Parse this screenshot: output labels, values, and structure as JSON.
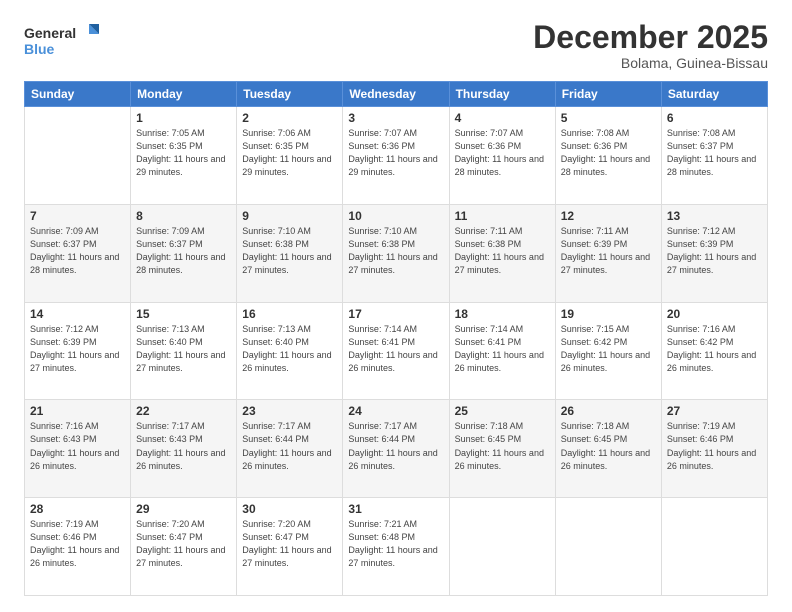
{
  "logo": {
    "line1": "General",
    "line2": "Blue"
  },
  "title": "December 2025",
  "location": "Bolama, Guinea-Bissau",
  "weekdays": [
    "Sunday",
    "Monday",
    "Tuesday",
    "Wednesday",
    "Thursday",
    "Friday",
    "Saturday"
  ],
  "weeks": [
    [
      {
        "day": "",
        "sunrise": "",
        "sunset": "",
        "daylight": ""
      },
      {
        "day": "1",
        "sunrise": "7:05 AM",
        "sunset": "6:35 PM",
        "daylight": "11 hours and 29 minutes."
      },
      {
        "day": "2",
        "sunrise": "7:06 AM",
        "sunset": "6:35 PM",
        "daylight": "11 hours and 29 minutes."
      },
      {
        "day": "3",
        "sunrise": "7:07 AM",
        "sunset": "6:36 PM",
        "daylight": "11 hours and 29 minutes."
      },
      {
        "day": "4",
        "sunrise": "7:07 AM",
        "sunset": "6:36 PM",
        "daylight": "11 hours and 28 minutes."
      },
      {
        "day": "5",
        "sunrise": "7:08 AM",
        "sunset": "6:36 PM",
        "daylight": "11 hours and 28 minutes."
      },
      {
        "day": "6",
        "sunrise": "7:08 AM",
        "sunset": "6:37 PM",
        "daylight": "11 hours and 28 minutes."
      }
    ],
    [
      {
        "day": "7",
        "sunrise": "7:09 AM",
        "sunset": "6:37 PM",
        "daylight": "11 hours and 28 minutes."
      },
      {
        "day": "8",
        "sunrise": "7:09 AM",
        "sunset": "6:37 PM",
        "daylight": "11 hours and 28 minutes."
      },
      {
        "day": "9",
        "sunrise": "7:10 AM",
        "sunset": "6:38 PM",
        "daylight": "11 hours and 27 minutes."
      },
      {
        "day": "10",
        "sunrise": "7:10 AM",
        "sunset": "6:38 PM",
        "daylight": "11 hours and 27 minutes."
      },
      {
        "day": "11",
        "sunrise": "7:11 AM",
        "sunset": "6:38 PM",
        "daylight": "11 hours and 27 minutes."
      },
      {
        "day": "12",
        "sunrise": "7:11 AM",
        "sunset": "6:39 PM",
        "daylight": "11 hours and 27 minutes."
      },
      {
        "day": "13",
        "sunrise": "7:12 AM",
        "sunset": "6:39 PM",
        "daylight": "11 hours and 27 minutes."
      }
    ],
    [
      {
        "day": "14",
        "sunrise": "7:12 AM",
        "sunset": "6:39 PM",
        "daylight": "11 hours and 27 minutes."
      },
      {
        "day": "15",
        "sunrise": "7:13 AM",
        "sunset": "6:40 PM",
        "daylight": "11 hours and 27 minutes."
      },
      {
        "day": "16",
        "sunrise": "7:13 AM",
        "sunset": "6:40 PM",
        "daylight": "11 hours and 26 minutes."
      },
      {
        "day": "17",
        "sunrise": "7:14 AM",
        "sunset": "6:41 PM",
        "daylight": "11 hours and 26 minutes."
      },
      {
        "day": "18",
        "sunrise": "7:14 AM",
        "sunset": "6:41 PM",
        "daylight": "11 hours and 26 minutes."
      },
      {
        "day": "19",
        "sunrise": "7:15 AM",
        "sunset": "6:42 PM",
        "daylight": "11 hours and 26 minutes."
      },
      {
        "day": "20",
        "sunrise": "7:16 AM",
        "sunset": "6:42 PM",
        "daylight": "11 hours and 26 minutes."
      }
    ],
    [
      {
        "day": "21",
        "sunrise": "7:16 AM",
        "sunset": "6:43 PM",
        "daylight": "11 hours and 26 minutes."
      },
      {
        "day": "22",
        "sunrise": "7:17 AM",
        "sunset": "6:43 PM",
        "daylight": "11 hours and 26 minutes."
      },
      {
        "day": "23",
        "sunrise": "7:17 AM",
        "sunset": "6:44 PM",
        "daylight": "11 hours and 26 minutes."
      },
      {
        "day": "24",
        "sunrise": "7:17 AM",
        "sunset": "6:44 PM",
        "daylight": "11 hours and 26 minutes."
      },
      {
        "day": "25",
        "sunrise": "7:18 AM",
        "sunset": "6:45 PM",
        "daylight": "11 hours and 26 minutes."
      },
      {
        "day": "26",
        "sunrise": "7:18 AM",
        "sunset": "6:45 PM",
        "daylight": "11 hours and 26 minutes."
      },
      {
        "day": "27",
        "sunrise": "7:19 AM",
        "sunset": "6:46 PM",
        "daylight": "11 hours and 26 minutes."
      }
    ],
    [
      {
        "day": "28",
        "sunrise": "7:19 AM",
        "sunset": "6:46 PM",
        "daylight": "11 hours and 26 minutes."
      },
      {
        "day": "29",
        "sunrise": "7:20 AM",
        "sunset": "6:47 PM",
        "daylight": "11 hours and 27 minutes."
      },
      {
        "day": "30",
        "sunrise": "7:20 AM",
        "sunset": "6:47 PM",
        "daylight": "11 hours and 27 minutes."
      },
      {
        "day": "31",
        "sunrise": "7:21 AM",
        "sunset": "6:48 PM",
        "daylight": "11 hours and 27 minutes."
      },
      {
        "day": "",
        "sunrise": "",
        "sunset": "",
        "daylight": ""
      },
      {
        "day": "",
        "sunrise": "",
        "sunset": "",
        "daylight": ""
      },
      {
        "day": "",
        "sunrise": "",
        "sunset": "",
        "daylight": ""
      }
    ]
  ]
}
